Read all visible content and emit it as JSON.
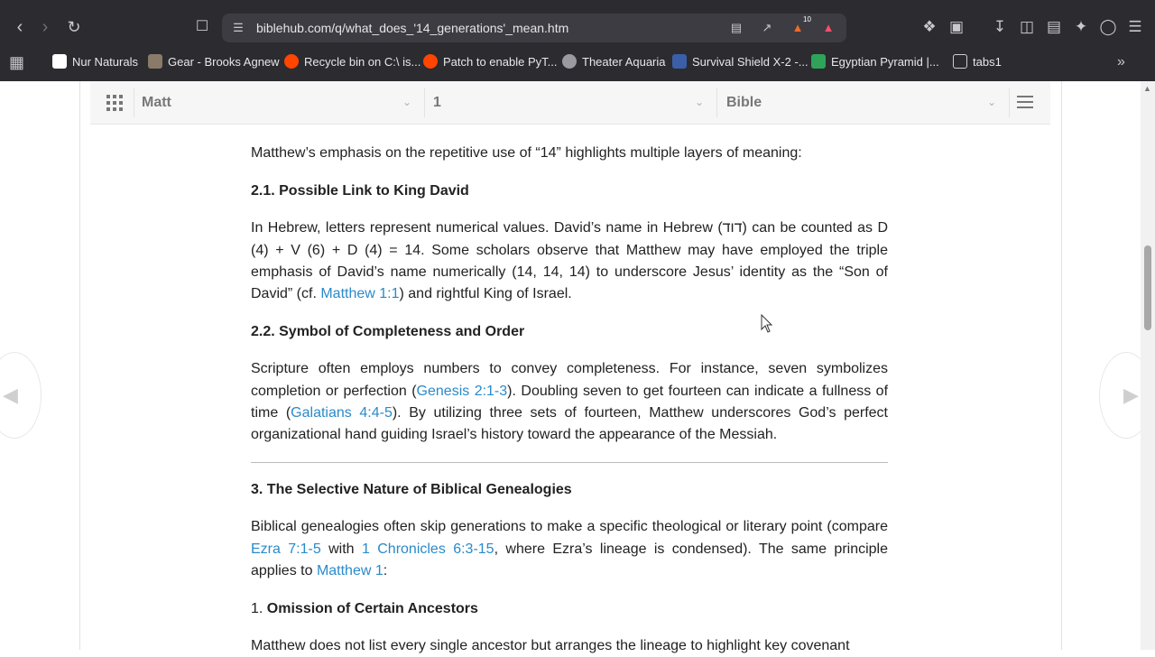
{
  "browser": {
    "url": "biblehub.com/q/what_does_'14_generations'_mean.htm",
    "brave_badge": "10",
    "bookmarks": [
      {
        "label": "Nur Naturals",
        "icon": "favicon-doc-icon"
      },
      {
        "label": "Gear - Brooks Agnew",
        "icon": "favicon-person-icon"
      },
      {
        "label": "Recycle bin on C:\\ is...",
        "icon": "reddit-icon"
      },
      {
        "label": "Patch to enable PyT...",
        "icon": "reddit-icon"
      },
      {
        "label": "Theater Aquaria",
        "icon": "globe-icon"
      },
      {
        "label": "Survival Shield X-2 -...",
        "icon": "favicon-product-icon"
      },
      {
        "label": "Egyptian Pyramid |...",
        "icon": "favicon-green-icon"
      },
      {
        "label": "tabs1",
        "icon": "folder-icon"
      }
    ]
  },
  "nav": {
    "book": "Matt",
    "chapter": "1",
    "version": "Bible"
  },
  "article": {
    "intro": "Matthew’s emphasis on the repetitive use of “14” highlights multiple layers of meaning:",
    "h21": "2.1. Possible Link to King David",
    "p21_a": "In Hebrew, letters represent numerical values. David’s name in Hebrew (דוד) can be counted as D (4) + V (6) + D (4) = 14. Some scholars observe that Matthew may have employed the triple emphasis of David’s name numerically (14, 14, 14) to underscore Jesus’ identity as the “Son of David” (cf. ",
    "p21_link": "Matthew 1:1",
    "p21_b": ") and rightful King of Israel.",
    "h22": "2.2. Symbol of Completeness and Order",
    "p22_a": "Scripture often employs numbers to convey completeness. For instance, seven symbolizes completion or perfection (",
    "p22_link1": "Genesis 2:1-3",
    "p22_b": "). Doubling seven to get fourteen can indicate a fullness of time (",
    "p22_link2": "Galatians 4:4-5",
    "p22_c": "). By utilizing three sets of fourteen, Matthew underscores God’s perfect organizational hand guiding Israel’s history toward the appearance of the Messiah.",
    "h3": "3. The Selective Nature of Biblical Genealogies",
    "p3_a": "Biblical genealogies often skip generations to make a specific theological or literary point (compare ",
    "p3_link1": "Ezra 7:1-5",
    "p3_b": " with ",
    "p3_link2": "1 Chronicles 6:3-15",
    "p3_c": ", where Ezra’s lineage is condensed). The same principle applies to ",
    "p3_link3": "Matthew 1",
    "p3_d": ":",
    "list1_num": "1. ",
    "list1_title": "Omission of Certain Ancestors",
    "p4_partial": "Matthew does not list every single ancestor but arranges the lineage to highlight key covenant"
  },
  "colors": {
    "link": "#2a8ac9",
    "chrome_bg": "#2b2b30"
  }
}
